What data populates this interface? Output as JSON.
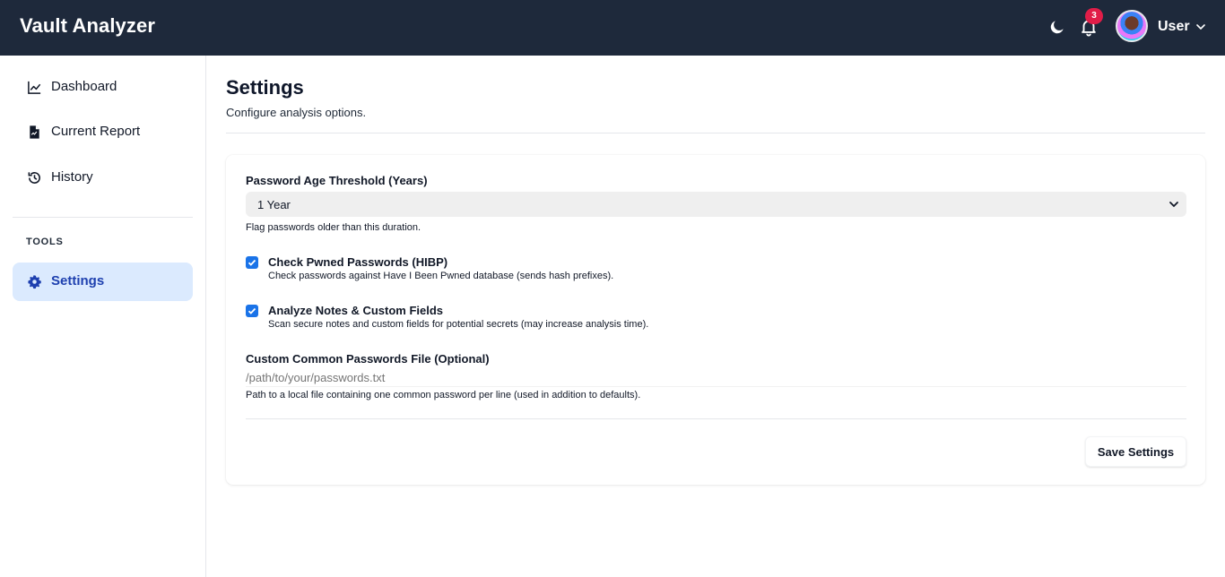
{
  "app": {
    "title": "Vault Analyzer"
  },
  "header": {
    "notification_count": "3",
    "user_label": "User",
    "icons": [
      "moon-icon",
      "bell-icon",
      "chevron-down-icon"
    ]
  },
  "sidebar": {
    "items": [
      {
        "label": "Dashboard",
        "icon": "chart-line-icon"
      },
      {
        "label": "Current Report",
        "icon": "file-report-icon"
      },
      {
        "label": "History",
        "icon": "history-icon"
      }
    ],
    "section_label": "TOOLS",
    "tools": [
      {
        "label": "Settings",
        "icon": "gear-icon",
        "active": true
      }
    ]
  },
  "page": {
    "title": "Settings",
    "subtitle": "Configure analysis options."
  },
  "settings": {
    "age_threshold": {
      "label": "Password Age Threshold (Years)",
      "value": "1 Year",
      "help": "Flag passwords older than this duration."
    },
    "hibp": {
      "label": "Check Pwned Passwords (HIBP)",
      "checked": true,
      "help": "Check passwords against Have I Been Pwned database (sends hash prefixes)."
    },
    "notes": {
      "label": "Analyze Notes & Custom Fields",
      "checked": true,
      "help": "Scan secure notes and custom fields for potential secrets (may increase analysis time)."
    },
    "custom_file": {
      "label": "Custom Common Passwords File (Optional)",
      "placeholder": "/path/to/your/passwords.txt",
      "help": "Path to a local file containing one common password per line (used in addition to defaults)."
    },
    "save_label": "Save Settings"
  },
  "colors": {
    "topbar": "#1e293b",
    "accent": "#1a73e8",
    "active_nav_bg": "#dbeafe",
    "badge": "#e11d48"
  }
}
